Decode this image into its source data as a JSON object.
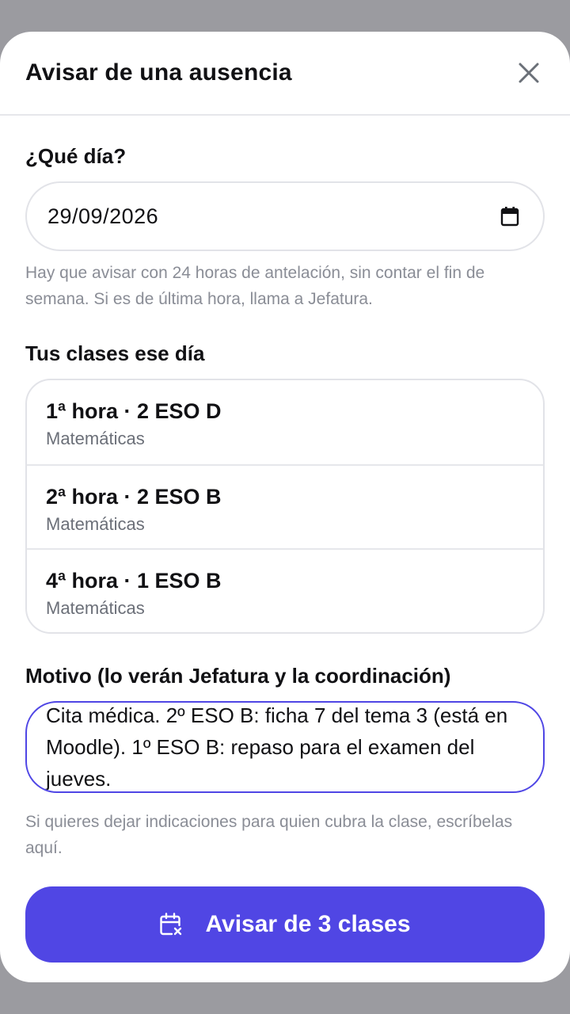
{
  "modal": {
    "title": "Avisar de una ausencia",
    "close_icon": "close-icon"
  },
  "date_section": {
    "label": "¿Qué día?",
    "value": "29/09/2026",
    "calendar_icon": "calendar-icon",
    "hint": "Hay que avisar con 24 horas de antelación, sin contar el fin de semana. Si es de última hora, llama a Jefatura."
  },
  "classes_section": {
    "label": "Tus clases ese día",
    "items": [
      {
        "title": "1ª hora · 2 ESO D",
        "subject": "Matemáticas"
      },
      {
        "title": "2ª hora · 2 ESO B",
        "subject": "Matemáticas"
      },
      {
        "title": "4ª hora · 1 ESO B",
        "subject": "Matemáticas"
      }
    ]
  },
  "reason_section": {
    "label": "Motivo (lo verán Jefatura y la coordinación)",
    "value": "Cita médica. 2º ESO B: ficha 7 del tema 3 (está en Moodle). 1º ESO B: repaso para el examen del jueves.",
    "hint": "Si quieres dejar indicaciones para quien cubra la clase, escríbelas aquí."
  },
  "submit": {
    "label": "Avisar de 3 clases",
    "icon": "calendar-x-icon"
  },
  "colors": {
    "accent": "#5046e4",
    "focus_border": "#4f46e5",
    "hint_text": "#8a8d96"
  }
}
